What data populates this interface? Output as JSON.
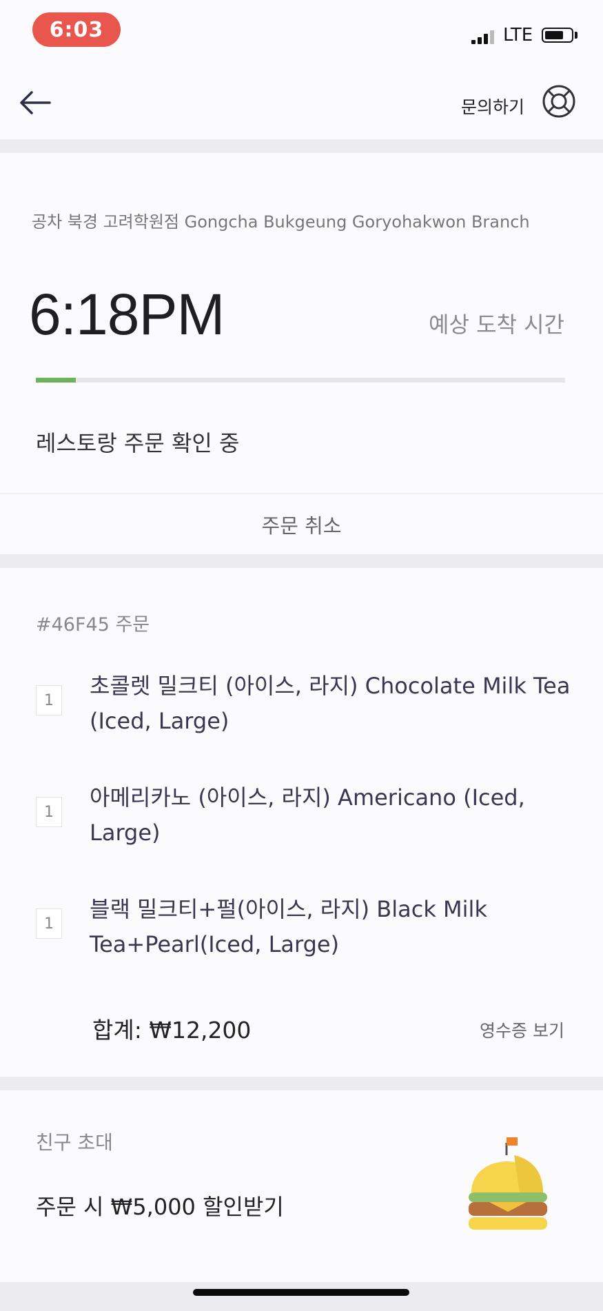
{
  "status_bar": {
    "time": "6:03",
    "network": "LTE"
  },
  "nav": {
    "help_label": "문의하기"
  },
  "order_status": {
    "store_name": "공차 북경 고려학원점 Gongcha Bukgeung Goryohakwon Branch",
    "eta_time": "6:18PM",
    "eta_label": "예상 도착 시간",
    "progress_fraction": 0.075,
    "progress_color": "#6db25f",
    "status_text": "레스토랑 주문 확인 중",
    "cancel_label": "주문 취소"
  },
  "order": {
    "title": "#46F45 주문",
    "items": [
      {
        "qty": "1",
        "name": "초콜렛 밀크티 (아이스, 라지) Chocolate Milk Tea (Iced, Large)"
      },
      {
        "qty": "1",
        "name": "아메리카노 (아이스, 라지)  Americano (Iced, Large)"
      },
      {
        "qty": "1",
        "name": "블랙 밀크티+펄(아이스, 라지) Black Milk Tea+Pearl(Iced, Large)"
      }
    ],
    "total": "합계: ₩12,200",
    "receipt_label": "영수증 보기"
  },
  "invite": {
    "title": "친구 초대",
    "text": "주문 시 ₩5,000 할인받기",
    "icon": "burger-icon"
  }
}
